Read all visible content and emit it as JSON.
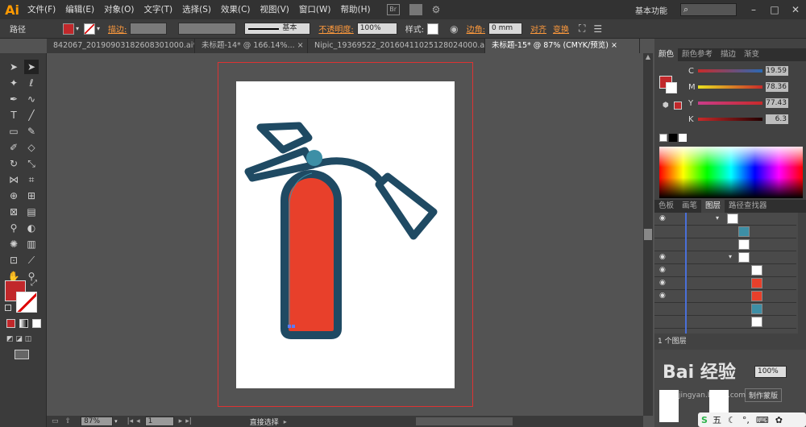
{
  "app": {
    "logo": "Ai",
    "workspace": "基本功能",
    "search_placeholder": ""
  },
  "menu": [
    "文件(F)",
    "编辑(E)",
    "对象(O)",
    "文字(T)",
    "选择(S)",
    "效果(C)",
    "视图(V)",
    "窗口(W)",
    "帮助(H)"
  ],
  "control_bar": {
    "selection_label": "路径",
    "stroke_label": "描边:",
    "stroke_style": "基本",
    "opacity_label": "不透明度:",
    "opacity_value": "100%",
    "style_label": "样式:",
    "corner_label": "边角:",
    "corner_value": "0 mm",
    "align_label": "对齐",
    "transform_label": "变换"
  },
  "tabs": [
    {
      "label": "842067_20190903182608301000.ai*",
      "active": false
    },
    {
      "label": "未标题-14* @ 166.14%...",
      "active": false
    },
    {
      "label": "Nipic_19369522_20160411025128024000.ai*",
      "active": false
    },
    {
      "label": "未标题-15* @ 87% (CMYK/预览)",
      "active": true
    }
  ],
  "status": {
    "zoom": "87%",
    "page": "1",
    "tool": "直接选择"
  },
  "color_panel": {
    "tabs": [
      "颜色",
      "颜色参考",
      "描边",
      "渐变"
    ],
    "channels": [
      {
        "name": "C",
        "value": "19.59"
      },
      {
        "name": "M",
        "value": "78.36"
      },
      {
        "name": "Y",
        "value": "77.43"
      },
      {
        "name": "K",
        "value": "6.3"
      }
    ],
    "fill_color": "#c1282b"
  },
  "layers_panel": {
    "tabs": [
      "色板",
      "画笔",
      "图层",
      "路径查找器"
    ],
    "count_label": "1 个图层"
  },
  "bottom_panel": {
    "opacity_value": "100%",
    "make_mask_label": "制作蒙版"
  },
  "watermark": {
    "text": "Bai 经验",
    "url": "jingyan.baidu.com"
  },
  "taskbar": {
    "ime": "五"
  },
  "colors": {
    "extinguisher_body": "#e8402b",
    "outline": "#1f4a63",
    "nozzle_dot": "#3d8fa6",
    "accent_orange": "#ff9a3c"
  }
}
